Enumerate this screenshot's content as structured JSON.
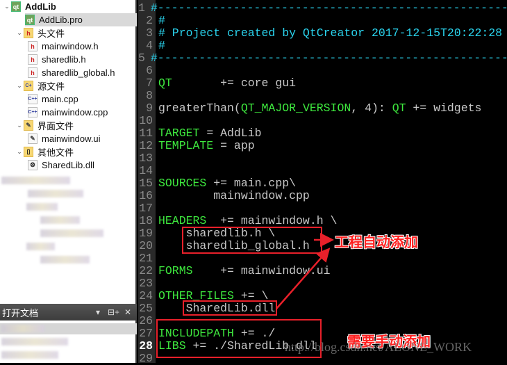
{
  "project_tree": [
    {
      "label": "AddLib",
      "icon": "qt-project-folder",
      "level": 0,
      "expanded": true,
      "bold": true
    },
    {
      "label": "AddLib.pro",
      "icon": "qt-pro-file",
      "level": 1,
      "selected": true
    },
    {
      "label": "头文件",
      "icon": "header-folder",
      "level": 1,
      "expanded": true
    },
    {
      "label": "mainwindow.h",
      "icon": "header-file",
      "level": 2
    },
    {
      "label": "sharedlib.h",
      "icon": "header-file",
      "level": 2
    },
    {
      "label": "sharedlib_global.h",
      "icon": "header-file",
      "level": 2
    },
    {
      "label": "源文件",
      "icon": "source-folder",
      "level": 1,
      "expanded": true
    },
    {
      "label": "main.cpp",
      "icon": "cpp-file",
      "level": 2
    },
    {
      "label": "mainwindow.cpp",
      "icon": "cpp-file",
      "level": 2
    },
    {
      "label": "界面文件",
      "icon": "forms-folder",
      "level": 1,
      "expanded": true
    },
    {
      "label": "mainwindow.ui",
      "icon": "ui-file",
      "level": 2
    },
    {
      "label": "其他文件",
      "icon": "other-folder",
      "level": 1,
      "expanded": true
    },
    {
      "label": "SharedLib.dll",
      "icon": "dll-file",
      "level": 2
    }
  ],
  "open_documents": {
    "title": "打开文档",
    "controls": {
      "dropdown": "▾",
      "split": "⊟+",
      "close": "✕"
    }
  },
  "editor": {
    "current_line": 28,
    "lines": [
      [
        [
          "c",
          "#-----------------------------------------------------"
        ]
      ],
      [
        [
          "c",
          "#"
        ]
      ],
      [
        [
          "c",
          "# Project created by QtCreator 2017-12-15T20:22:28"
        ]
      ],
      [
        [
          "c",
          "#"
        ]
      ],
      [
        [
          "c",
          "#-----------------------------------------------------"
        ]
      ],
      [],
      [
        [
          "k",
          "QT"
        ],
        [
          "t",
          "       += core gui"
        ]
      ],
      [],
      [
        [
          "t",
          "greaterThan("
        ],
        [
          "k",
          "QT_MAJOR_VERSION"
        ],
        [
          "t",
          ", 4): "
        ],
        [
          "k",
          "QT"
        ],
        [
          "t",
          " += widgets"
        ]
      ],
      [],
      [
        [
          "k",
          "TARGET"
        ],
        [
          "t",
          " = AddLib"
        ]
      ],
      [
        [
          "k",
          "TEMPLATE"
        ],
        [
          "t",
          " = app"
        ]
      ],
      [],
      [],
      [
        [
          "k",
          "SOURCES"
        ],
        [
          "t",
          " += main.cpp\\"
        ]
      ],
      [
        [
          "t",
          "        mainwindow.cpp"
        ]
      ],
      [],
      [
        [
          "k",
          "HEADERS"
        ],
        [
          "t",
          "  += mainwindow.h \\"
        ]
      ],
      [
        [
          "t",
          "    sharedlib.h \\"
        ]
      ],
      [
        [
          "t",
          "    sharedlib_global.h"
        ]
      ],
      [],
      [
        [
          "k",
          "FORMS"
        ],
        [
          "t",
          "    += mainwindow.ui"
        ]
      ],
      [],
      [
        [
          "k",
          "OTHER_FILES"
        ],
        [
          "t",
          " += \\"
        ]
      ],
      [
        [
          "t",
          "    SharedLib.dll"
        ]
      ],
      [],
      [
        [
          "k",
          "INCLUDEPATH"
        ],
        [
          "t",
          " += ./"
        ]
      ],
      [
        [
          "k",
          "LIBS"
        ],
        [
          "t",
          " += ./SharedLib.dll"
        ]
      ],
      []
    ]
  },
  "annotations": {
    "auto_added": "工程自动添加",
    "manual_added": "需要手动添加",
    "color": "#e8202a"
  },
  "watermark": "http://blog.csdn.net/ALONE_WORK",
  "colors": {
    "keyword": "#3ee83e",
    "comment": "#2ad4ee",
    "text": "#c8c8c8",
    "background": "#000000"
  }
}
